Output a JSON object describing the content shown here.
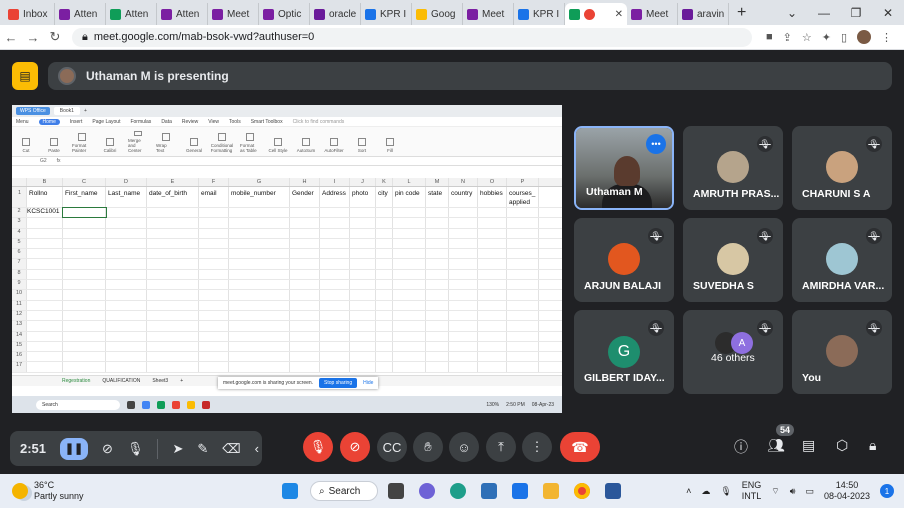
{
  "browser": {
    "tabs": [
      {
        "label": "Inbox",
        "color": "#ea4335"
      },
      {
        "label": "Atten",
        "color": "#7b1fa2"
      },
      {
        "label": "Atten",
        "color": "#0f9d58"
      },
      {
        "label": "Atten",
        "color": "#7b1fa2"
      },
      {
        "label": "Meet",
        "color": "#7b1fa2"
      },
      {
        "label": "Optic",
        "color": "#7b1fa2"
      },
      {
        "label": "oracle",
        "color": "#6a1b9a"
      },
      {
        "label": "KPR I",
        "color": "#1a73e8"
      },
      {
        "label": "Goog",
        "color": "#fbbc04"
      },
      {
        "label": "Meet",
        "color": "#7b1fa2"
      },
      {
        "label": "KPR I",
        "color": "#1a73e8"
      },
      {
        "label": "",
        "color": "#0f9d58",
        "active": true
      },
      {
        "label": "Meet",
        "color": "#7b1fa2"
      },
      {
        "label": "aravin",
        "color": "#6a1b9a"
      }
    ],
    "url": "meet.google.com/mab-bsok-vwd?authuser=0"
  },
  "presenting": {
    "text": "Uthaman M is presenting"
  },
  "spreadsheet": {
    "app_tab": "WPS Office",
    "file_tab": "Book1",
    "menu_items": [
      "Menu",
      "Home",
      "Insert",
      "Page Layout",
      "Formulas",
      "Data",
      "Review",
      "View",
      "Tools",
      "Smart Toolbox"
    ],
    "find_placeholder": "Click to find commands",
    "ribbon_items": [
      "Cut",
      "Paste",
      "Format Painter",
      "Calibri",
      "Merge and Center",
      "Wrap Text",
      "General",
      "Conditional Formatting",
      "Format as Table",
      "Cell Style",
      "AutoSum",
      "AutoFilter",
      "Sort",
      "Fill"
    ],
    "cell_ref": "G2",
    "columns": [
      {
        "letter": "B",
        "header": "Rollno"
      },
      {
        "letter": "C",
        "header": "First_name"
      },
      {
        "letter": "D",
        "header": "Last_name"
      },
      {
        "letter": "E",
        "header": "date_of_birth"
      },
      {
        "letter": "F",
        "header": "email"
      },
      {
        "letter": "G",
        "header": "mobile_number"
      },
      {
        "letter": "H",
        "header": "Gender"
      },
      {
        "letter": "I",
        "header": "Address"
      },
      {
        "letter": "J",
        "header": "photo"
      },
      {
        "letter": "K",
        "header": "city"
      },
      {
        "letter": "L",
        "header": "pin code"
      },
      {
        "letter": "M",
        "header": "state"
      },
      {
        "letter": "N",
        "header": "country"
      },
      {
        "letter": "O",
        "header": "hobbies"
      },
      {
        "letter": "P",
        "header": "courses_ applied"
      }
    ],
    "row2_value": "KCSC1001",
    "row_numbers": [
      "1",
      "2",
      "3",
      "4",
      "5",
      "6",
      "7",
      "8",
      "9",
      "10",
      "11",
      "12",
      "13",
      "14",
      "15",
      "16",
      "17"
    ],
    "sheets": [
      "Regestration",
      "QUALIFICATION",
      "Sheet3"
    ],
    "share_note": "meet.google.com is sharing your screen.",
    "stop_sharing": "Stop sharing",
    "hide": "Hide",
    "zoom": "130%",
    "mini_search": "Search",
    "mini_clock": "2:50 PM",
    "mini_date": "08-Apr-23"
  },
  "participants": [
    {
      "name": "Uthaman M",
      "type": "video"
    },
    {
      "name": "AMRUTH PRAS...",
      "type": "photo",
      "color": "#b5a48c"
    },
    {
      "name": "CHARUNI S A",
      "type": "photo",
      "color": "#c9a27e"
    },
    {
      "name": "ARJUN BALAJI",
      "type": "photo",
      "color": "#e2571f"
    },
    {
      "name": "SUVEDHA S",
      "type": "photo",
      "color": "#d7c7a4"
    },
    {
      "name": "AMIRDHA VAR...",
      "type": "photo",
      "color": "#9ec6d3"
    },
    {
      "name": "GILBERT IDAY...",
      "type": "letter",
      "letter": "G"
    },
    {
      "name": "46 others",
      "type": "others",
      "letter": "A"
    },
    {
      "name": "You",
      "type": "photo",
      "color": "#8b6b58"
    }
  ],
  "controls": {
    "time": "2:51",
    "participant_count": "54"
  },
  "taskbar": {
    "temp": "36°C",
    "weather": "Partly sunny",
    "search": "Search",
    "lang1": "ENG",
    "lang2": "INTL",
    "time": "14:50",
    "date": "08-04-2023",
    "notifications": "1"
  }
}
